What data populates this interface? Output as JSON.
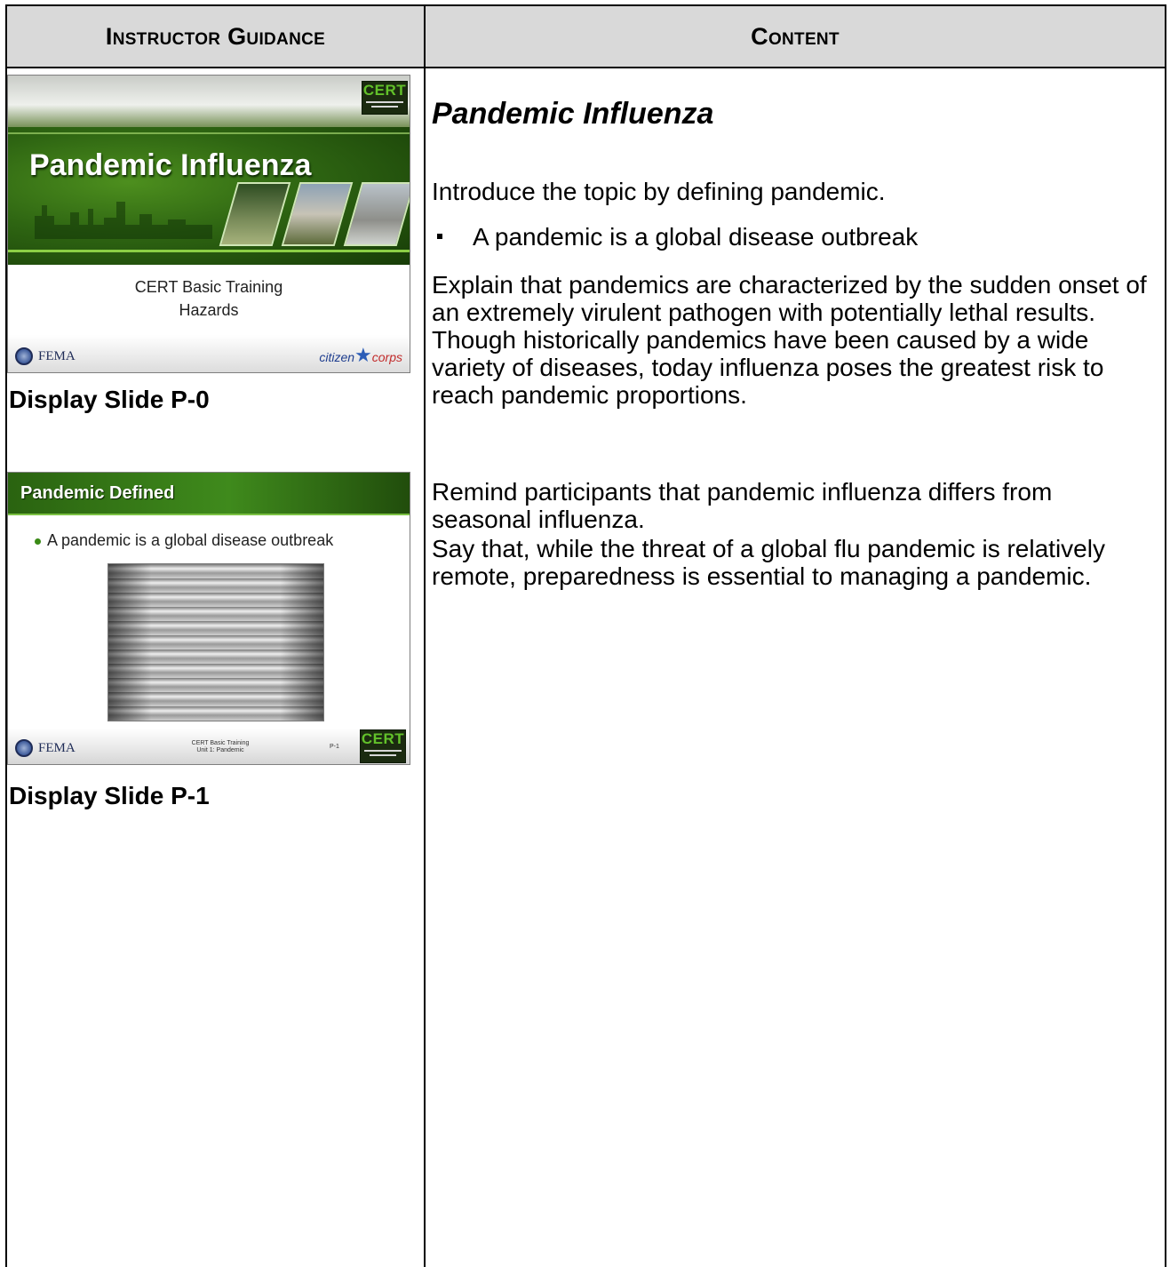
{
  "table": {
    "header_left": "Instructor Guidance",
    "header_right": "Content"
  },
  "slides": [
    {
      "title": "Pandemic Influenza",
      "logo": "CERT",
      "subtitle_line1": "CERT Basic Training",
      "subtitle_line2": "Hazards",
      "fema": "FEMA",
      "citizen_prefix": "citizen",
      "citizen_suffix": "corps",
      "caption": "Display Slide P-0"
    },
    {
      "title": "Pandemic Defined",
      "bullet": "A pandemic is a global disease outbreak",
      "logo": "CERT",
      "fema": "FEMA",
      "footer_line1": "CERT Basic Training",
      "footer_line2": "Unit 1: Pandemic",
      "page": "P-1",
      "caption": "Display Slide P-1"
    }
  ],
  "content": {
    "title": "Pandemic Influenza",
    "intro": "Introduce the topic by defining pandemic.",
    "bullet": "A pandemic is a global disease outbreak",
    "explain": "Explain that pandemics are characterized by the sudden onset of an extremely virulent pathogen with potentially lethal results. Though historically pandemics have been caused by a wide variety of diseases, today influenza poses the greatest risk to reach pandemic proportions.",
    "remind": "Remind participants that pandemic influenza differs from seasonal influenza.",
    "say": "Say that, while the threat of a global flu pandemic is relatively remote, preparedness is essential to managing a pandemic."
  },
  "colors": {
    "header_bg": "#d9d9d9",
    "slide_green": "#2e6512",
    "cert_green": "#62c12a"
  }
}
